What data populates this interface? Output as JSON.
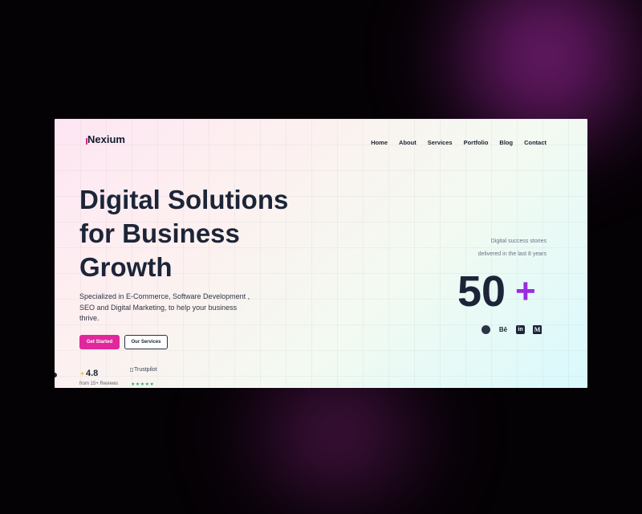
{
  "brand": {
    "name": "Nexium",
    "accent": "#e0279b"
  },
  "nav": {
    "items": [
      "Home",
      "About",
      "Services",
      "Portfolio",
      "Blog",
      "Contact"
    ]
  },
  "hero": {
    "title": "Digital Solutions for Business Growth",
    "subtitle": "Specialized in E-Commerce, Software Development , SEO and Digital Marketing, to help your business thrive.",
    "primary_cta": "Get Started",
    "secondary_cta": "Our Services"
  },
  "rating": {
    "value": "4.8",
    "star": "★",
    "note": "from 15+ Reviews",
    "trustpilot_alt": "Trustpilot",
    "trustpilot_stars": "★★★★★"
  },
  "stats": {
    "caption_line1": "Digital success stories",
    "caption_line2": "delivered in the last 8 years",
    "number": "50",
    "suffix": "+"
  },
  "socials": {
    "behance_text": "Bē",
    "linkedin_text": "in",
    "medium_text": "M"
  },
  "colors": {
    "text_dark": "#1c2538",
    "plus_purple": "#9a2ce0",
    "trustpilot_green": "#22b463",
    "star_yellow": "#f5b50a"
  }
}
